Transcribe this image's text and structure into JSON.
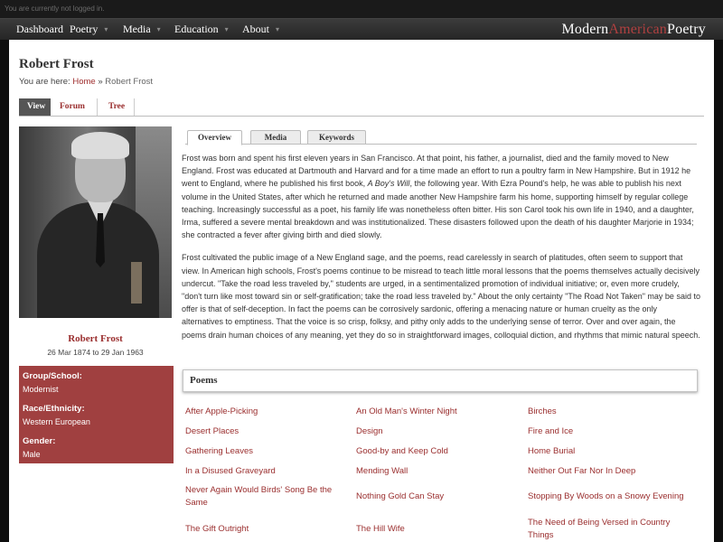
{
  "topbar": {
    "status": "You are currently not logged in."
  },
  "nav": {
    "items": [
      "Dashboard",
      "Poetry",
      "Media",
      "Education",
      "About"
    ],
    "caret": "▾",
    "brand_part1": "Modern",
    "brand_part2": "American",
    "brand_part3": "Poetry"
  },
  "page": {
    "title": "Robert Frost",
    "breadcrumb_prefix": "You are here:",
    "breadcrumb_home": "Home",
    "breadcrumb_sep": "»",
    "breadcrumb_current": "Robert Frost"
  },
  "page_tabs": [
    "View",
    "Forum",
    "Tree"
  ],
  "author": {
    "name": "Robert Frost",
    "dates": "26 Mar 1874 to 29 Jan 1963",
    "info": [
      {
        "label": "Group/School:",
        "value": "Modernist"
      },
      {
        "label": "Race/Ethnicity:",
        "value": "Western European"
      },
      {
        "label": "Gender:",
        "value": "Male"
      }
    ]
  },
  "content_tabs": [
    "Overview",
    "Media",
    "Keywords"
  ],
  "bio": {
    "p1_a": "Frost was born and spent his first eleven years in San Francisco. At that point, his father, a journalist, died and the family moved to New England. Frost was educated at Dartmouth and Harvard and for a time made an effort to run a poultry farm in New Hampshire. But in 1912 he went to England, where he published his first book, ",
    "p1_book": "A Boy's Will",
    "p1_b": ", the following year. With Ezra Pound's help, he was able to publish his next volume in the United States, after which he returned and made another New Hampshire farm his home, supporting himself by regular college teaching. Increasingly successful as a poet, his family life was nonetheless often bitter. His son Carol took his own life in 1940, and a daughter, Irma, suffered a severe mental breakdown and was institutionalized. These disasters followed upon the death of his daughter Marjorie in 1934; she contracted a fever after giving birth and died slowly.",
    "p2": "Frost cultivated the public image of a New England sage, and the poems, read carelessly in search of platitudes, often seem to support that view. In American high schools, Frost's poems continue to be misread to teach little moral lessons that the poems themselves actually decisively undercut. \"Take the road less traveled by,\" students are urged, in a sentimentalized promotion of individual initiative; or, even more crudely, \"don't turn like most toward sin or self-gratification; take the road less traveled by.\" About the only certainty \"The Road Not Taken\" may be said to offer is that of self-deception. In fact the poems can be corrosively sardonic, offering a menacing nature or human cruelty as the only alternatives to emptiness. That the voice is so crisp, folksy, and pithy only adds to the underlying sense of terror. Over and over again, the poems drain human choices of any meaning, yet they do so in straightforward images, colloquial diction, and rhythms that mimic natural speech."
  },
  "poems": {
    "heading": "Poems",
    "items": [
      "After Apple-Picking",
      "An Old Man's Winter Night",
      "Birches",
      "Desert Places",
      "Design",
      "Fire and Ice",
      "Gathering Leaves",
      "Good-by and Keep Cold",
      "Home Burial",
      "In a Disused Graveyard",
      "Mending Wall",
      "Neither Out Far Nor In Deep",
      "Never Again Would Birds' Song Be the Same",
      "Nothing Gold Can Stay",
      "Stopping By Woods on a Snowy Evening",
      "The Gift Outright",
      "The Hill Wife",
      "The Need of Being Versed in Country Things"
    ]
  }
}
